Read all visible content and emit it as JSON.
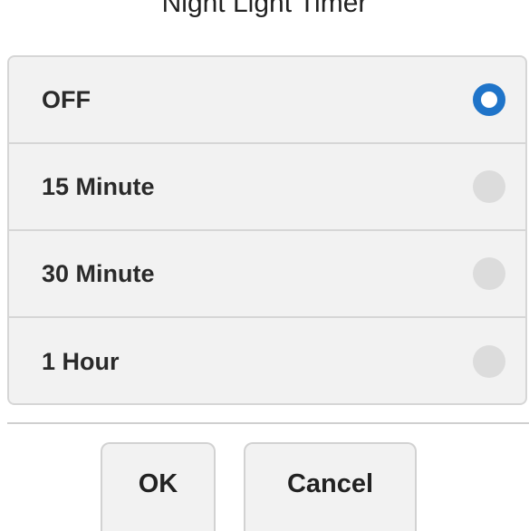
{
  "dialog": {
    "title": "Night Light Timer"
  },
  "options": [
    {
      "label": "OFF",
      "selected": true
    },
    {
      "label": "15 Minute",
      "selected": false
    },
    {
      "label": "30 Minute",
      "selected": false
    },
    {
      "label": "1 Hour",
      "selected": false
    }
  ],
  "buttons": {
    "ok_label": "OK",
    "cancel_label": "Cancel"
  },
  "colors": {
    "accent": "#1f74c9",
    "panel_bg": "#f2f2f2",
    "border": "#d6d6d6",
    "radio_off": "#dcdcdc"
  }
}
